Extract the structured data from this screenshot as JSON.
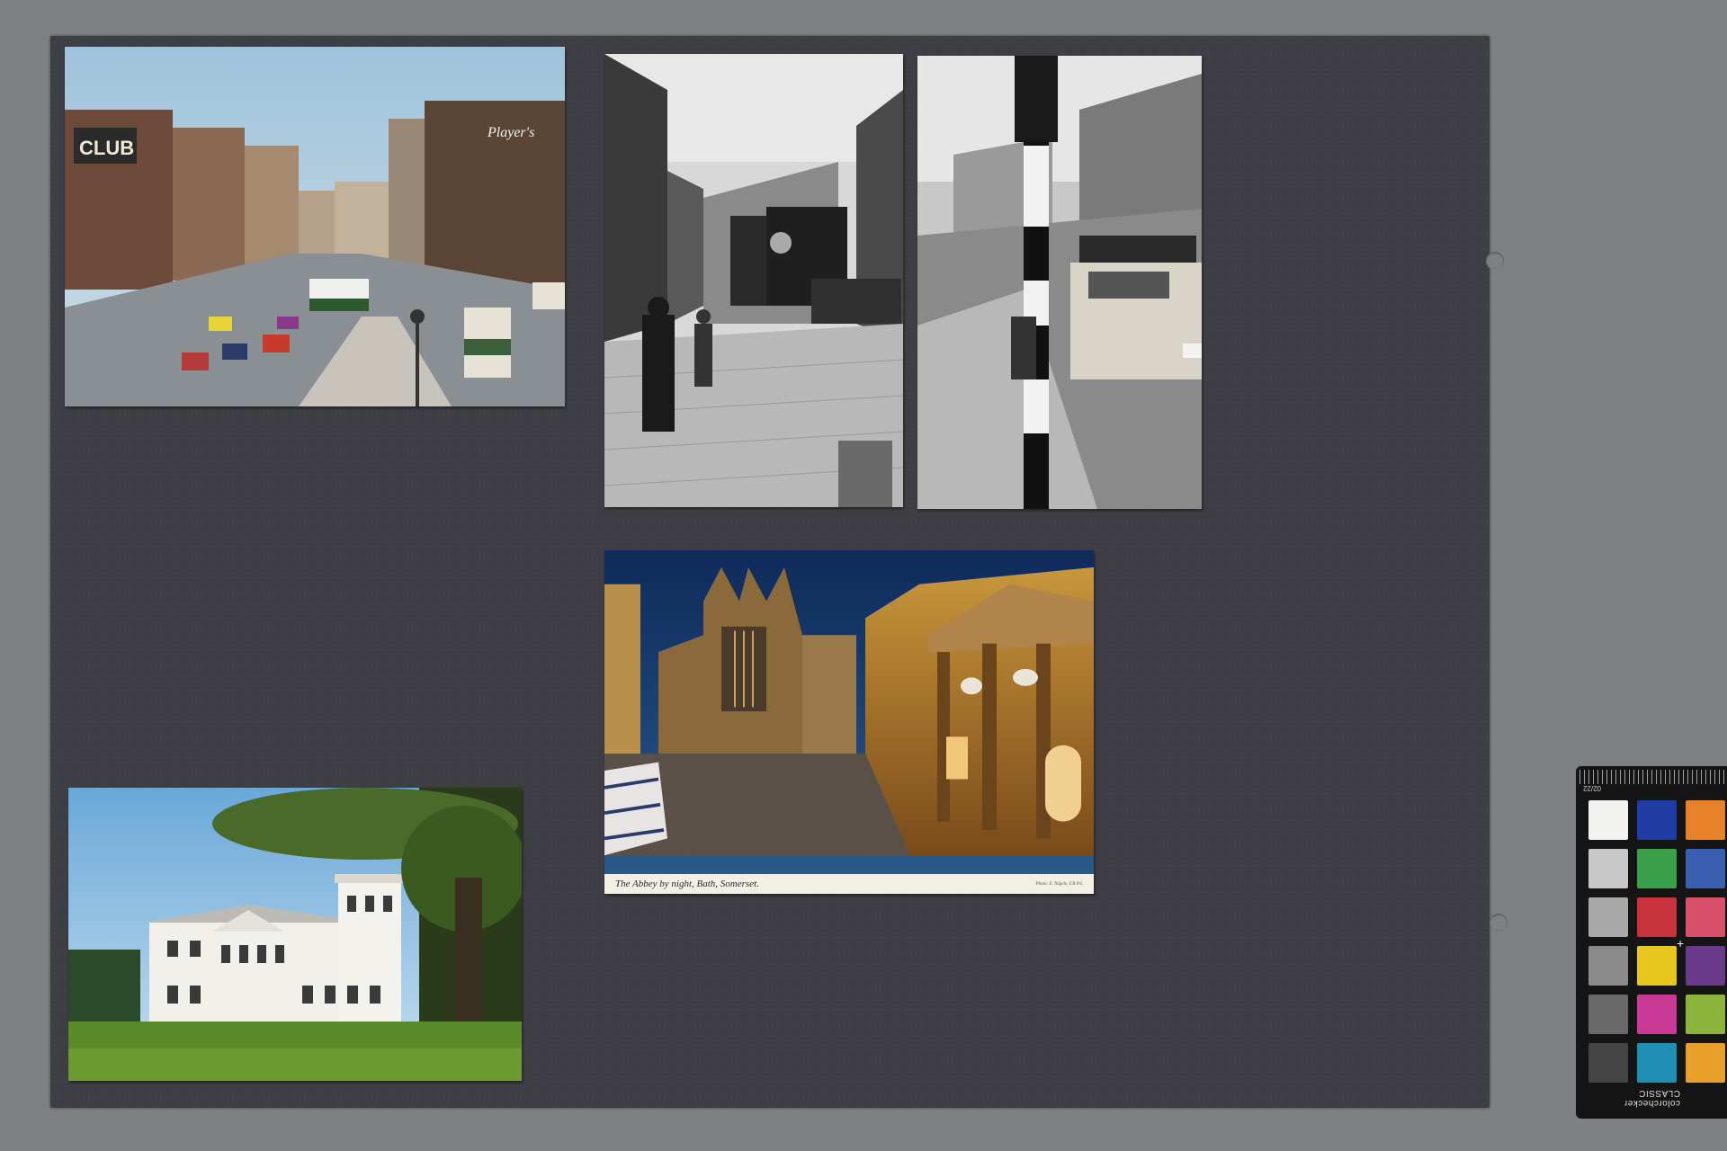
{
  "board": {
    "label": "Mounting board with five postcards"
  },
  "postcards": [
    {
      "id": "color-street-bus",
      "kind": "color"
    },
    {
      "id": "bw-street-truck",
      "kind": "black-and-white"
    },
    {
      "id": "bw-street-pole",
      "kind": "black-and-white"
    },
    {
      "id": "bath-abbey-night",
      "kind": "color",
      "caption": "The Abbey by night, Bath, Somerset.",
      "credit": "Photo: E. Nägele, F.R.P.S."
    },
    {
      "id": "white-mansion-tree",
      "kind": "color"
    }
  ],
  "color_checker": {
    "label": "colorchecker CLASSIC",
    "ruler_text": "02/22",
    "swatches": [
      "#f2f2f0",
      "#1f3ca5",
      "#e8822a",
      "#c8c8c8",
      "#3aa04a",
      "#3a5fb0",
      "#a9a9a9",
      "#c8323c",
      "#d84f6a",
      "#8a8a8a",
      "#e8c81e",
      "#6a3a8a",
      "#6a6a6a",
      "#c83a96",
      "#8ab43a",
      "#444444",
      "#1f90b4",
      "#e8a02a"
    ]
  }
}
